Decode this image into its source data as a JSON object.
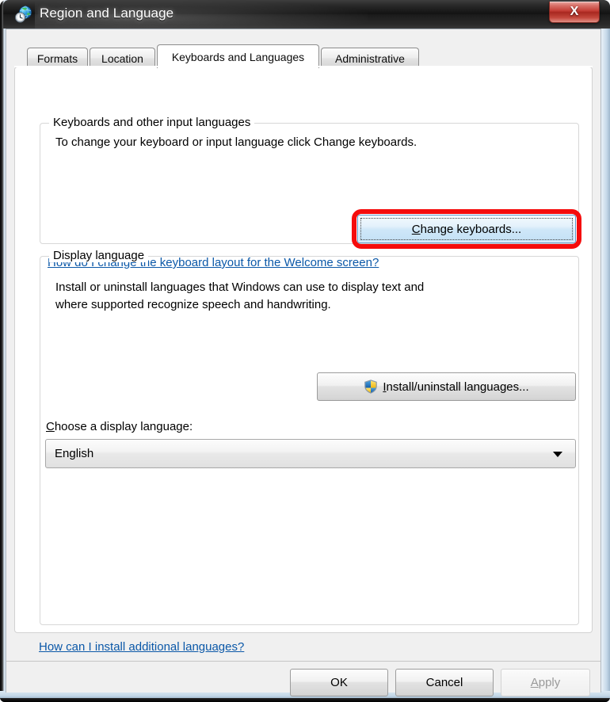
{
  "window": {
    "title": "Region and Language",
    "icon": "globe-clock-icon",
    "close_label": "X"
  },
  "tabs": [
    {
      "label": "Formats",
      "active": false
    },
    {
      "label": "Location",
      "active": false
    },
    {
      "label": "Keyboards and Languages",
      "active": true
    },
    {
      "label": "Administrative",
      "active": false
    }
  ],
  "keyboards_group": {
    "legend": "Keyboards and other input languages",
    "description": "To change your keyboard or input language click Change keyboards.",
    "change_keyboards_button": {
      "accel": "C",
      "rest": "hange keyboards...",
      "focused": true,
      "highlighted": true
    },
    "help_link": "How do I change the keyboard layout for the Welcome screen?"
  },
  "display_group": {
    "legend": "Display language",
    "description_line1": "Install or uninstall languages that Windows can use to display text and",
    "description_line2": "where supported recognize speech and handwriting.",
    "install_button": {
      "icon": "uac-shield-icon",
      "accel": "I",
      "rest": "nstall/uninstall languages..."
    },
    "choose_label": {
      "accel": "C",
      "before": "",
      "rest": "hoose a display language:"
    },
    "combo": {
      "value": "English",
      "arrow": "chevron-down-icon"
    }
  },
  "bottom_link": "How can I install additional languages?",
  "footer": {
    "ok_label": "OK",
    "cancel_label": "Cancel",
    "apply": {
      "accel": "A",
      "rest": "pply",
      "disabled": true
    }
  },
  "colors": {
    "annotation_red": "#f50c0c",
    "link_blue": "#0b58a8",
    "titlebar_dark": "#131313",
    "close_red": "#c23b33"
  }
}
